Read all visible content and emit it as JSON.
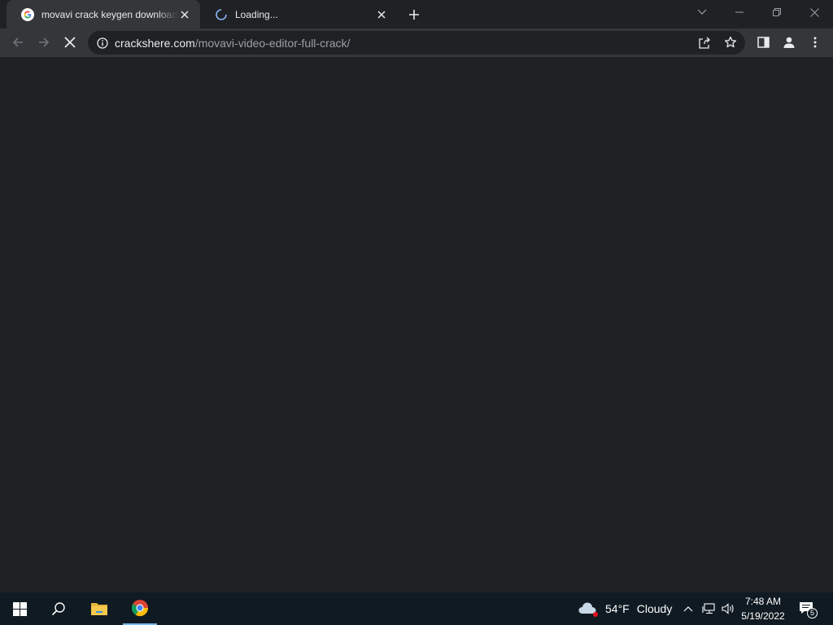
{
  "tabs": [
    {
      "title": "movavi crack keygen download - Google Search",
      "favicon": "google-g-icon",
      "active": true
    },
    {
      "title": "Loading...",
      "favicon": "loading-spinner-icon",
      "active": false
    }
  ],
  "toolbar": {
    "url_host": "crackshere.com",
    "url_path": "/movavi-video-editor-full-crack/"
  },
  "taskbar": {
    "weather_temp": "54°F",
    "weather_desc": "Cloudy",
    "time": "7:48 AM",
    "date": "5/19/2022",
    "notification_count": "5"
  },
  "colors": {
    "background": "#202124",
    "tab_active": "#35363a",
    "taskbar": "#0f1a22",
    "accent": "#76b9ed"
  }
}
